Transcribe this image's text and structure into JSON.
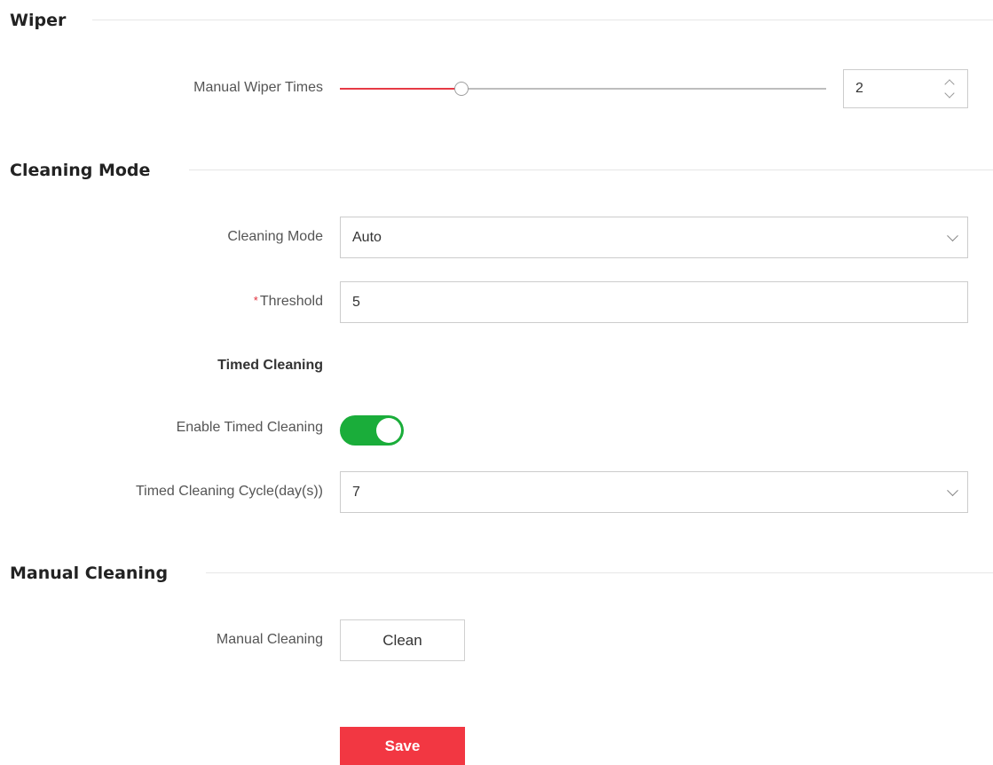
{
  "sections": {
    "wiper": "Wiper",
    "cleaning_mode": "Cleaning Mode",
    "manual_cleaning": "Manual Cleaning"
  },
  "wiper": {
    "label": "Manual Wiper Times",
    "value": "2",
    "slider_fraction": 0.25
  },
  "cleaning": {
    "mode_label": "Cleaning Mode",
    "mode_value": "Auto",
    "threshold_required": "*",
    "threshold_label": "Threshold",
    "threshold_value": "5",
    "timed_heading": "Timed Cleaning",
    "enable_label": "Enable Timed Cleaning",
    "enable_on": true,
    "cycle_label": "Timed Cleaning Cycle(day(s))",
    "cycle_value": "7"
  },
  "manual": {
    "label": "Manual Cleaning",
    "button": "Clean"
  },
  "save_button": "Save",
  "colors": {
    "accent": "#f23742",
    "toggle_on": "#1aad3a"
  }
}
